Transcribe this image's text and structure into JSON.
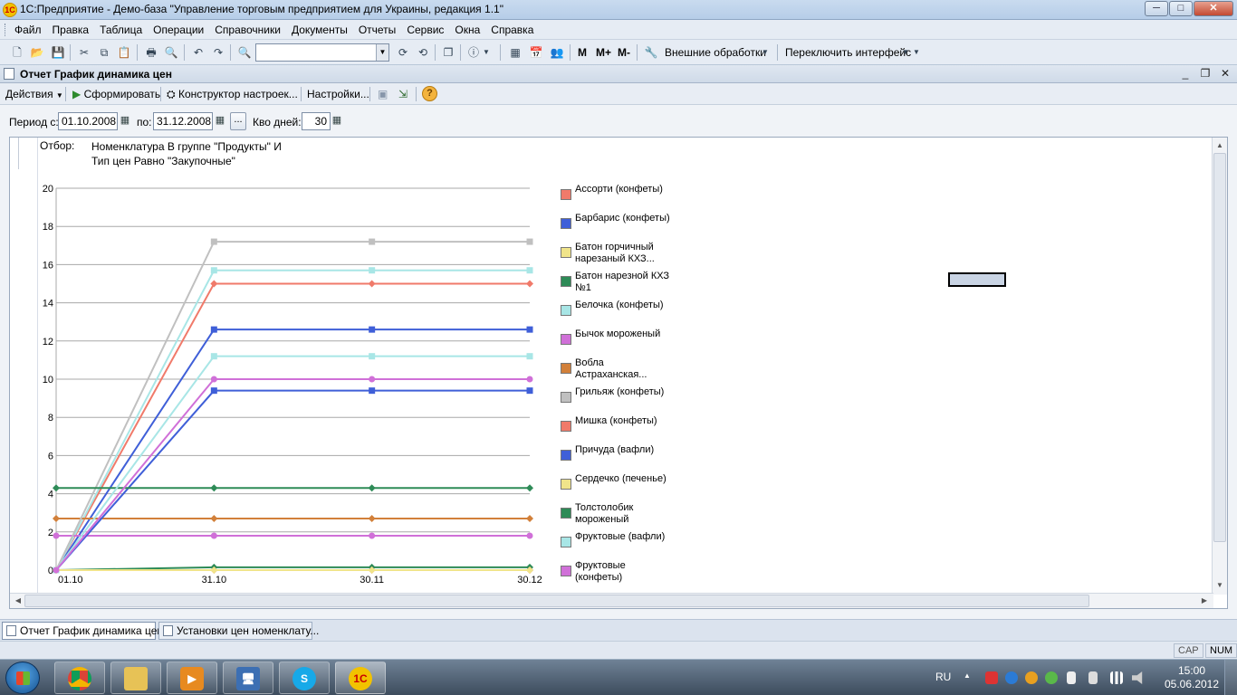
{
  "window": {
    "title": "1С:Предприятие - Демо-база \"Управление торговым предприятием для Украины, редакция 1.1\"",
    "buttons": {
      "minimize": "─",
      "maximize": "□",
      "close": "✕"
    }
  },
  "menu": {
    "items": [
      "Файл",
      "Правка",
      "Таблица",
      "Операции",
      "Справочники",
      "Документы",
      "Отчеты",
      "Сервис",
      "Окна",
      "Справка"
    ]
  },
  "toolbar": {
    "search_value": "",
    "memory_m": "M",
    "memory_mplus": "M+",
    "memory_mminus": "M-",
    "external_processing": "Внешние обработки",
    "switch_interface": "Переключить интерфейс"
  },
  "document": {
    "title": "Отчет  График динамика цен",
    "actions": "Действия",
    "generate": "Сформировать",
    "constructor": "Конструктор настроек...",
    "settings": "Настройки...",
    "help": "?"
  },
  "filter": {
    "period_from_label": "Период с:",
    "period_from": "01.10.2008",
    "period_to_label": "по:",
    "period_to": "31.12.2008",
    "dots": "...",
    "days_label": "Кво дней:",
    "days": "30"
  },
  "report": {
    "otbor_label": "Отбор:",
    "otbor_line1": "Номенклатура В группе \"Продукты\" И",
    "otbor_line2": "Тип цен Равно \"Закупочные\""
  },
  "chart_data": {
    "type": "line",
    "title": "",
    "xlabel": "",
    "ylabel": "",
    "x": [
      "01.10",
      "31.10",
      "30.11",
      "30.12"
    ],
    "ylim": [
      0,
      20
    ],
    "yticks": [
      0,
      2,
      4,
      6,
      8,
      10,
      12,
      14,
      16,
      18,
      20
    ],
    "grid": true,
    "legend_position": "right",
    "series": [
      {
        "name": "Ассорти (конфеты)",
        "color": "#f07a6a",
        "marker": "diamond",
        "values": [
          0,
          15.0,
          15.0,
          15.0
        ]
      },
      {
        "name": "Барбарис (конфеты)",
        "color": "#3f5fd8",
        "marker": "square",
        "values": [
          0,
          12.6,
          12.6,
          12.6
        ]
      },
      {
        "name": "Батон горчичный нарезаный  КХЗ...",
        "color": "#f0e48a",
        "marker": "diamond",
        "values": [
          0,
          0,
          0,
          0
        ]
      },
      {
        "name": "Батон нарезной КХЗ №1",
        "color": "#2e8b57",
        "marker": "diamond",
        "values": [
          0,
          0.15,
          0.15,
          0.15
        ]
      },
      {
        "name": "Белочка (конфеты)",
        "color": "#a8e6e6",
        "marker": "square",
        "values": [
          0,
          15.7,
          15.7,
          15.7
        ]
      },
      {
        "name": "Бычок мороженый",
        "color": "#d070d8",
        "marker": "circle",
        "values": [
          1.8,
          1.8,
          1.8,
          1.8
        ]
      },
      {
        "name": "Вобла Астраханская...",
        "color": "#d2803a",
        "marker": "diamond",
        "values": [
          2.7,
          2.7,
          2.7,
          2.7
        ]
      },
      {
        "name": "Грильяж (конфеты)",
        "color": "#c0c0c0",
        "marker": "square",
        "values": [
          0,
          17.2,
          17.2,
          17.2
        ]
      },
      {
        "name": "Мишка (конфеты)",
        "color": "#f07a6a",
        "marker": "diamond",
        "values": [
          0,
          0,
          0,
          0
        ]
      },
      {
        "name": "Причуда (вафли)",
        "color": "#3f5fd8",
        "marker": "square",
        "values": [
          0,
          9.4,
          9.4,
          9.4
        ]
      },
      {
        "name": "Сердечко (печенье)",
        "color": "#f0e48a",
        "marker": "diamond",
        "values": [
          0,
          0,
          0,
          0
        ]
      },
      {
        "name": "Толстолобик мороженый",
        "color": "#2e8b57",
        "marker": "diamond",
        "values": [
          4.3,
          4.3,
          4.3,
          4.3
        ]
      },
      {
        "name": "Фруктовые (вафли)",
        "color": "#a8e6e6",
        "marker": "square",
        "values": [
          0,
          11.2,
          11.2,
          11.2
        ]
      },
      {
        "name": "Фруктовые (конфеты)",
        "color": "#d070d8",
        "marker": "circle",
        "values": [
          0,
          10.0,
          10.0,
          10.0
        ]
      }
    ]
  },
  "window_tabs": [
    "Отчет  График динамика цен",
    "Установки цен номенклату..."
  ],
  "status": {
    "cap": "CAP",
    "num": "NUM"
  },
  "taskbar": {
    "lang": "RU",
    "time": "15:00",
    "date": "05.06.2012"
  }
}
